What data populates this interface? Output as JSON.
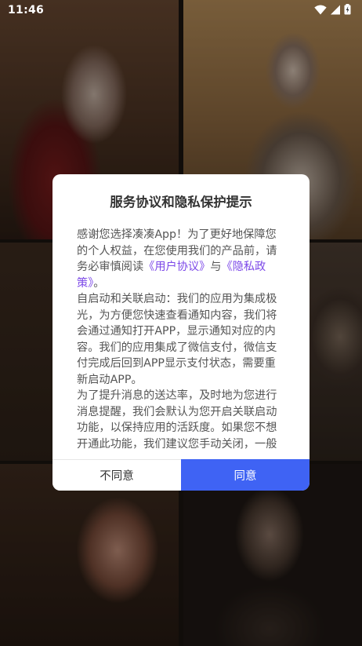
{
  "status_bar": {
    "time": "11:46",
    "icons": [
      "wifi-icon",
      "signal-icon",
      "battery-icon"
    ]
  },
  "dialog": {
    "title": "服务协议和隐私保护提示",
    "intro_prefix": "感谢您选择凑凑App！为了更好地保障您的个人权益，在您使用我们的产品前，请务必审慎阅读",
    "user_agreement_link": "《用户协议》",
    "connector": "与",
    "privacy_policy_link": "《隐私政策》",
    "intro_suffix": "。",
    "paragraph_2": "自启动和关联启动：我们的应用为集成极光，为方便您快速查看通知内容，我们将会通过通知打开APP，显示通知对应的内容。我们的应用集成了微信支付，微信支付完成后回到APP显示支付状态，需要重新启动APP。",
    "paragraph_3": "为了提升消息的送达率，及时地为您进行消息提醒，我们会默认为您开启关联启动功能，以保持应用的活跃度。如果您不想开通此功能，我们建议您手动关闭，一般",
    "disagree_label": "不同意",
    "agree_label": "同意"
  },
  "colors": {
    "link": "#7c48e8",
    "agree_button": "#3f63f4"
  }
}
